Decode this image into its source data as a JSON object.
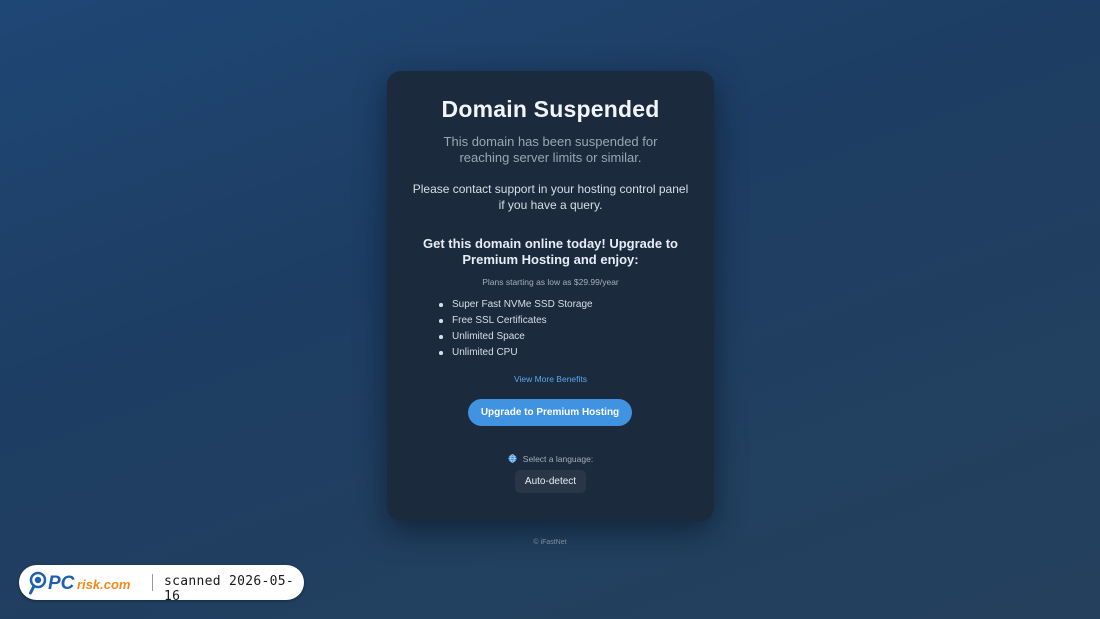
{
  "page": {
    "title": "Domain Suspended",
    "subtitle": "This domain has been suspended for reaching server limits or similar.",
    "contact_text": "Please contact support in your hosting control panel if you have a query.",
    "promo_heading": "Get this domain online today! Upgrade to Premium Hosting and enjoy:",
    "plans_note": "Plans starting as low as $29.99/year",
    "benefits": [
      "Super Fast NVMe SSD Storage",
      "Free SSL Certificates",
      "Unlimited Space",
      "Unlimited CPU"
    ],
    "more_link": "View More Benefits",
    "upgrade_button": "Upgrade to Premium Hosting",
    "language_label": "Select a language:",
    "language_selected": "Auto-detect",
    "copyright": "© iFastNet"
  },
  "watermark": {
    "logo_text": "PCrisk.com",
    "scan_text": "scanned 2026-05-16"
  },
  "icons": {
    "language": "globe-icon",
    "logo": "magnifier-logo"
  },
  "colors": {
    "background": "#1f4775",
    "card": "#1c2a3d",
    "accent": "#3f93e0",
    "link": "#5aa7ee",
    "brand_blue": "#1e5fb0",
    "brand_orange": "#f08a1c"
  }
}
